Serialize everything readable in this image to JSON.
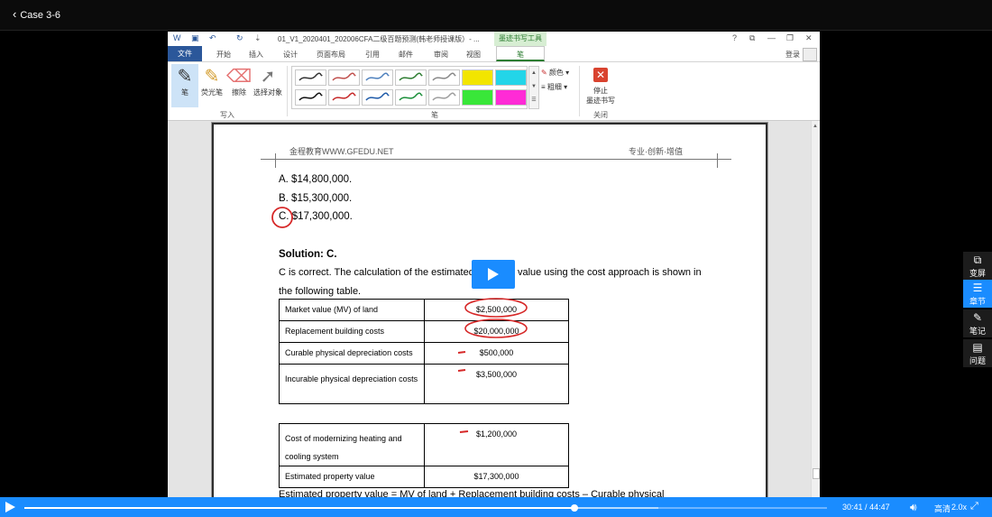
{
  "player": {
    "back_label": "Case 3-6",
    "current_time": "30:41",
    "separator": "/",
    "total_time": "44:47",
    "progress": 0.685,
    "buffered": 0.79,
    "quality_label": "高清",
    "speed_label": "2.0x"
  },
  "side_panel": [
    {
      "label": "变屏",
      "icon": "window-switch-icon"
    },
    {
      "label": "章节",
      "icon": "chapters-icon"
    },
    {
      "label": "笔记",
      "icon": "pencil-icon"
    },
    {
      "label": "问题",
      "icon": "question-icon"
    }
  ],
  "word": {
    "title": "01_V1_2020401_202006CFA二级百题预测(韩老师授课版）- ...",
    "ink_tools_tab": "墨迹书写工具",
    "window_controls": [
      "?",
      "⧉",
      "—",
      "❐",
      "✕"
    ],
    "tabs": [
      "文件",
      "开始",
      "插入",
      "设计",
      "页面布局",
      "引用",
      "邮件",
      "审阅",
      "视图",
      "笔"
    ],
    "login": "登录",
    "ribbon": {
      "write_tools": [
        "笔",
        "荧光笔",
        "擦除",
        "选择对象"
      ],
      "write_group": "写入",
      "pens_group": "笔",
      "color_label": "颜色",
      "thickness_label": "粗细",
      "stop_label_1": "停止",
      "stop_label_2": "墨迹书写",
      "close_group": "关闭"
    },
    "pen_colors": [
      "#333333",
      "#c0504d",
      "#4f81bd",
      "#2e7d32",
      "#888888",
      "#f2e500",
      "#23d5e8",
      "#111111",
      "#c62828",
      "#1e5aa8",
      "#1b8f3a",
      "#9e9e9e",
      "#39e639",
      "#ff2bd6"
    ]
  },
  "doc": {
    "header_left": "金程教育WWW.GFEDU.NET",
    "header_right": "专业·创新·增值",
    "answers": [
      "A.  $14,800,000.",
      "B.  $15,300,000.",
      "C.  $17,300,000."
    ],
    "solution": "Solution: C.",
    "para1_a": "C is correct. The calculation of the estimated",
    "para1_b": "value using the cost approach is shown in",
    "para2": "the following table.",
    "table1": [
      {
        "label": "Market value (MV) of land",
        "value": "$2,500,000"
      },
      {
        "label": "Replacement building costs",
        "value": "$20,000,000"
      },
      {
        "label": "Curable physical depreciation costs",
        "value": "$500,000"
      },
      {
        "label": "Incurable physical depreciation costs",
        "value": "$3,500,000"
      }
    ],
    "table2": [
      {
        "label": "Cost of modernizing heating and cooling system",
        "value": "$1,200,000"
      },
      {
        "label": "Estimated property value",
        "value": "$17,300,000"
      }
    ],
    "footer_line": "Estimated   property   value   =   MV   of   land   +   Replacement   building   costs   –   Curable   physical"
  }
}
